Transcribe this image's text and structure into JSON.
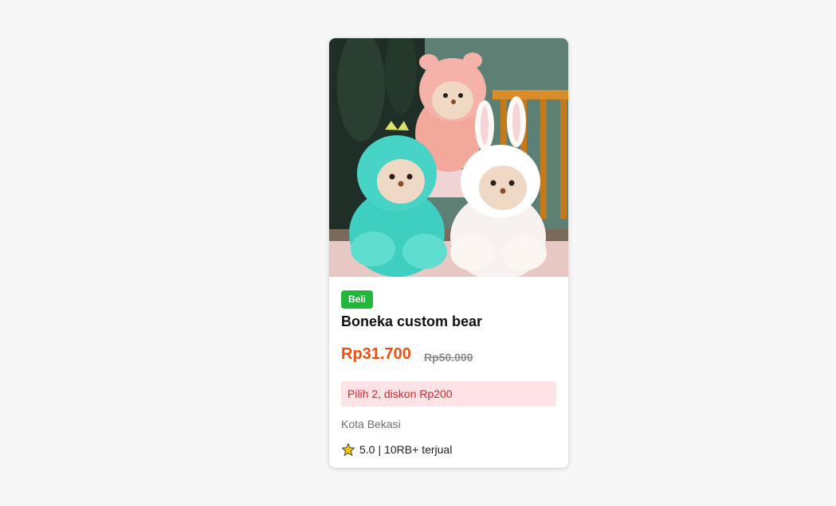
{
  "product": {
    "image_icon": "plush-bears-photo",
    "badge": "Beli",
    "name": "Boneka custom bear",
    "price": "Rp31.700",
    "original_price": "Rp50.000",
    "promo": "Pilih 2, diskon Rp200",
    "location": "Kota Bekasi",
    "rating_icon": "star-icon",
    "rating": "5.0",
    "separator": "|",
    "sold": "10RB+ terjual"
  },
  "colors": {
    "badge_bg": "#22b73c",
    "price": "#e8510f",
    "promo_bg": "#fde3e5",
    "promo_text": "#d62828",
    "star": "#f5c400"
  }
}
